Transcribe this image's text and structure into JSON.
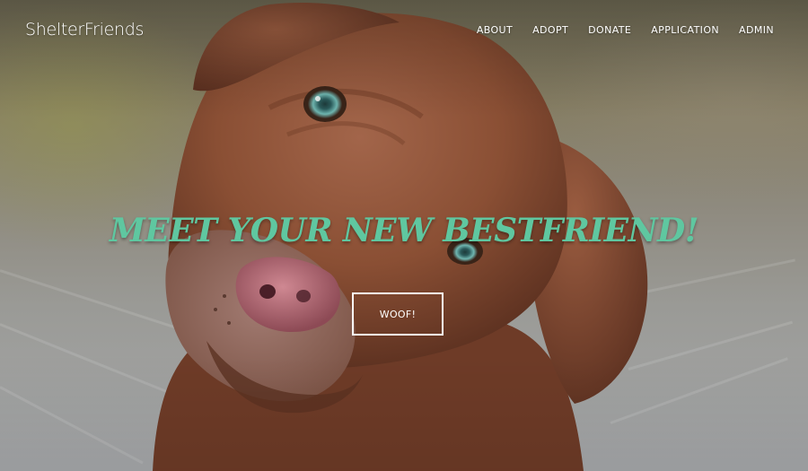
{
  "brand": {
    "name": "ShelterFriends"
  },
  "nav": {
    "items": [
      {
        "label": "ABOUT"
      },
      {
        "label": "ADOPT"
      },
      {
        "label": "DONATE"
      },
      {
        "label": "APPLICATION"
      },
      {
        "label": "ADMIN"
      }
    ]
  },
  "hero": {
    "headline": "MEET YOUR NEW BESTFRIEND!",
    "cta_label": "WOOF!",
    "image": "puppy-photo"
  },
  "colors": {
    "headline": "#5fc7a0",
    "nav_text": "#ffffff",
    "button_border": "#ffffff",
    "dog_fur": "#8a4f34"
  }
}
